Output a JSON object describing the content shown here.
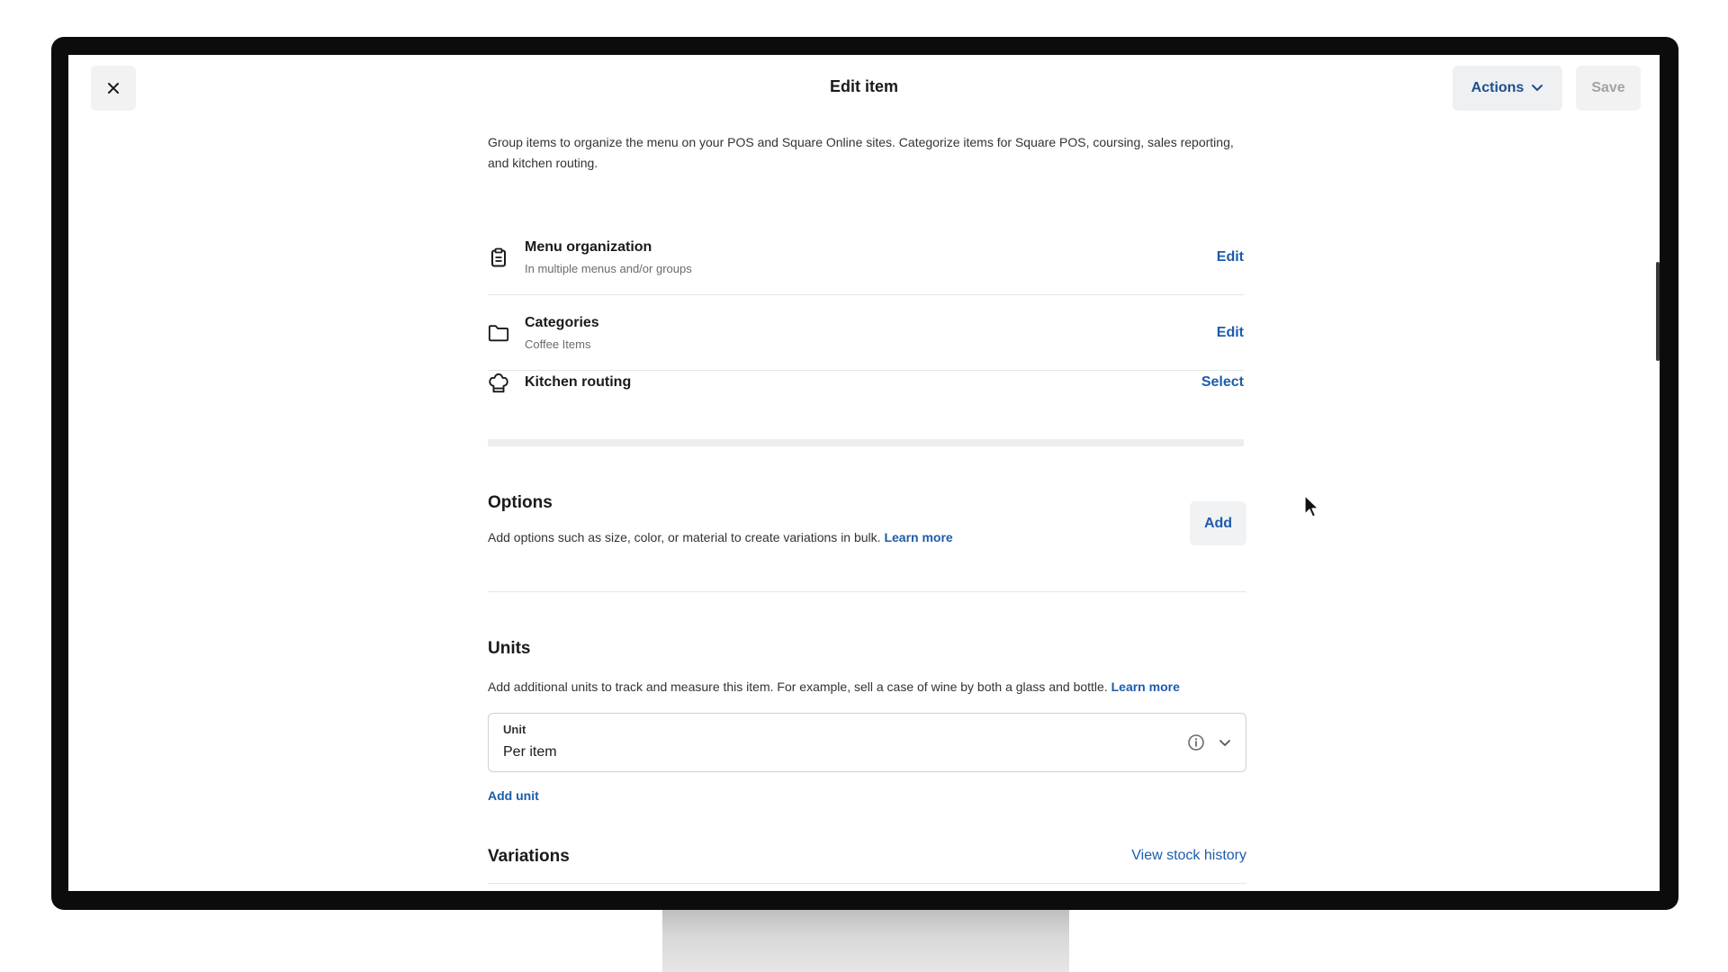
{
  "header": {
    "title": "Edit item",
    "actions_label": "Actions",
    "save_label": "Save"
  },
  "intro": "Group items to organize the menu on your POS and Square Online sites. Categorize items for Square POS, coursing, sales reporting, and kitchen routing.",
  "organization": [
    {
      "icon": "clipboard-icon",
      "title": "Menu organization",
      "subtitle": "In multiple menus and/or groups",
      "action": "Edit"
    },
    {
      "icon": "folder-icon",
      "title": "Categories",
      "subtitle": "Coffee Items",
      "action": "Edit"
    },
    {
      "icon": "chef-hat-icon",
      "title": "Kitchen routing",
      "subtitle": "",
      "action": "Select"
    }
  ],
  "options": {
    "title": "Options",
    "description": "Add options such as size, color, or material to create variations in bulk.",
    "learn_more": "Learn more",
    "add_label": "Add"
  },
  "units": {
    "title": "Units",
    "description": "Add additional units to track and measure this item. For example, sell a case of wine by both a glass and bottle.",
    "learn_more": "Learn more",
    "field_label": "Unit",
    "field_value": "Per item",
    "add_unit_label": "Add unit"
  },
  "variations": {
    "title": "Variations",
    "stock_history_label": "View stock history"
  },
  "colors": {
    "link": "#1d5cab",
    "bezel": "#0c0c0c",
    "button_bg": "#f0f2f4"
  }
}
